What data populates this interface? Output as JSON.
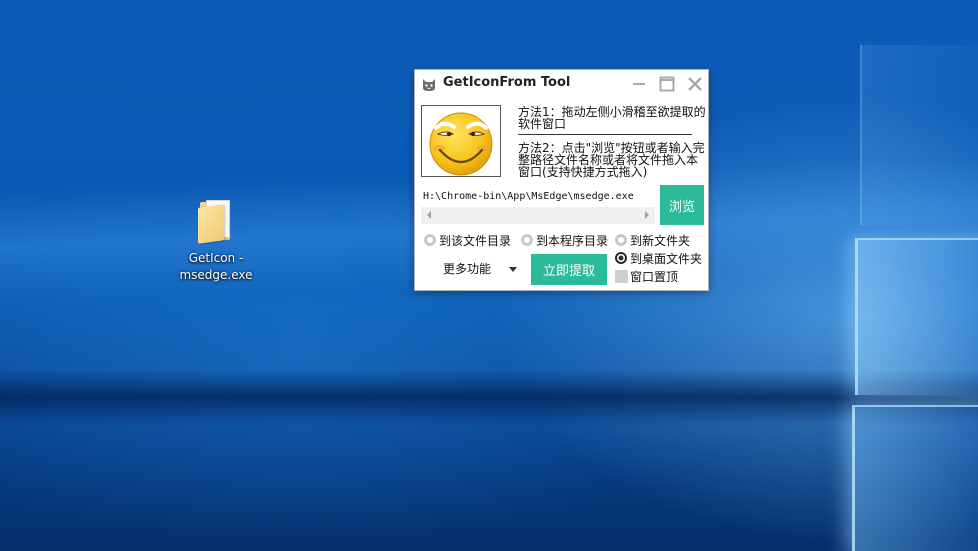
{
  "desktop": {
    "icon": {
      "name": "folder-icon",
      "label_line1": "GetIcon -",
      "label_line2": "msedge.exe"
    }
  },
  "window": {
    "title": "GetIconFrom Tool",
    "app_icon": "cat-icon",
    "controls": {
      "minimize": "minimize-icon",
      "maximize": "maximize-icon",
      "close": "close-icon"
    },
    "logo": "smiley-face-icon",
    "method1": "方法1：拖动左侧小滑稽至欲提取的软件窗口",
    "method2": "方法2：点击\"浏览\"按钮或者输入完整路径文件名称或者将文件拖入本窗口(支持快捷方式拖入)",
    "path_value": "H:\\Chrome-bin\\App\\MsEdge\\msedge.exe",
    "browse_label": "浏览",
    "radio_options": [
      {
        "label": "到该文件目录",
        "checked": false
      },
      {
        "label": "到本程序目录",
        "checked": false
      },
      {
        "label": "到新文件夹",
        "checked": false
      },
      {
        "label": "到桌面文件夹",
        "checked": true
      }
    ],
    "topmost_label": "窗口置顶",
    "topmost_checked": false,
    "more_label": "更多功能",
    "extract_label": "立即提取"
  },
  "colors": {
    "accent": "#2bbb9a",
    "desktop_blue": "#0b5ab5"
  }
}
